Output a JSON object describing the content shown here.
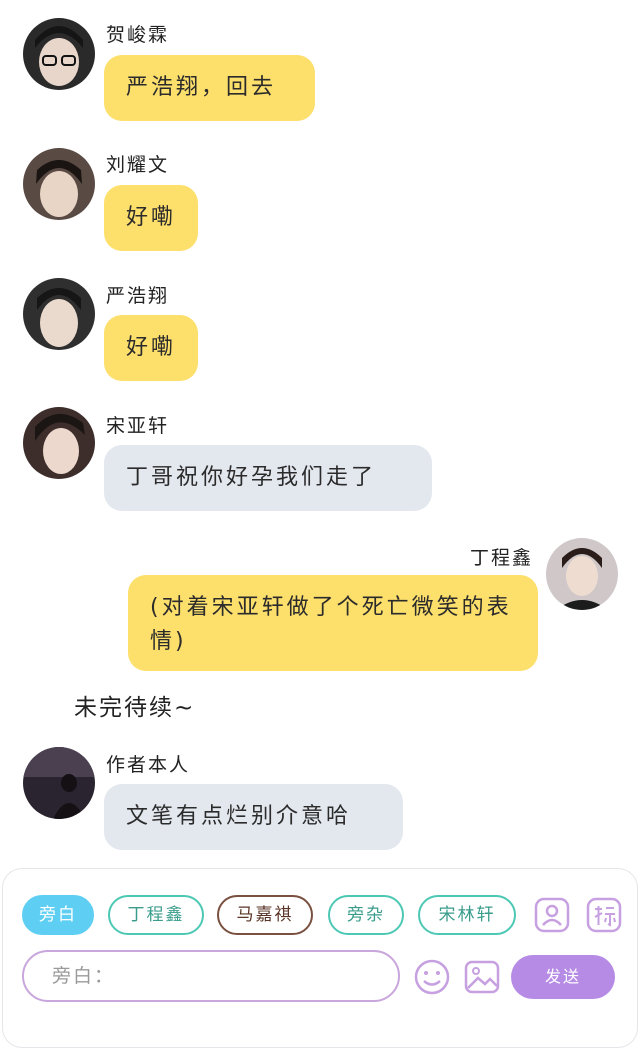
{
  "messages": [
    {
      "name": "贺峻霖",
      "text": "严浩翔，回去"
    },
    {
      "name": "刘耀文",
      "text": "好嘞"
    },
    {
      "name": "严浩翔",
      "text": "好嘞"
    },
    {
      "name": "宋亚轩",
      "text": "丁哥祝你好孕我们走了"
    },
    {
      "name": "丁程鑫",
      "text": "(对着宋亚轩做了个死亡微笑的表情)"
    },
    {
      "name": "作者本人",
      "text": "文笔有点烂别介意哈"
    }
  ],
  "narration": "未完待续~",
  "composer": {
    "roles": [
      "旁白",
      "丁程鑫",
      "马嘉祺",
      "旁杂",
      "宋林轩"
    ],
    "active_role": 0,
    "input_placeholder": "旁白：",
    "send_label": "发送",
    "icons": [
      "contact-card-icon",
      "tag-icon",
      "emoji-icon",
      "image-icon"
    ],
    "colors": {
      "active": "#5ecff3",
      "teal": "#4cc8b4",
      "brown": "#7a5040",
      "send": "#b68be5",
      "input_border": "#c9a6dc"
    }
  },
  "colors": {
    "yellow_bubble": "#fddf6c",
    "gray_bubble": "#e3e7ee"
  }
}
